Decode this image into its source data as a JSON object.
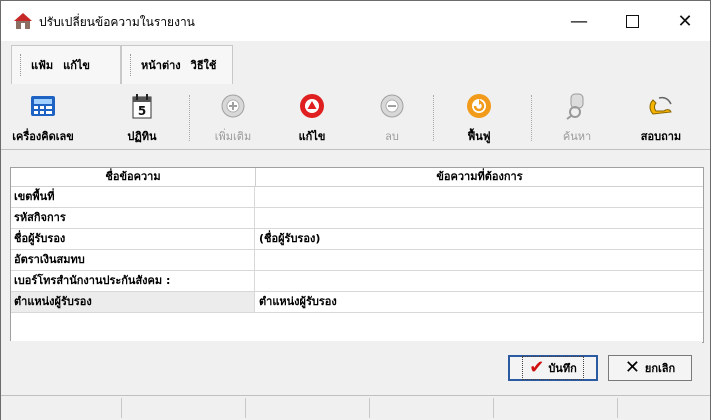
{
  "window": {
    "title": "ปรับเปลี่ยนข้อความในรายงาน",
    "min_icon": "minimize-icon",
    "max_icon": "maximize-icon",
    "close_icon": "close-icon"
  },
  "menu": {
    "file_items": [
      "แฟ้ม",
      "แก้ไข"
    ],
    "window_items": [
      "หน้าต่าง",
      "วิธีใช้"
    ]
  },
  "toolbar": {
    "calculator": "เครื่องคิดเลข",
    "calendar": "ปฏิทิน",
    "calendar_day": "5",
    "add": "เพิ่มเติม",
    "edit": "แก้ไข",
    "delete": "ลบ",
    "restore": "ฟื้นฟู",
    "search": "ค้นหา",
    "inquire": "สอบถาม"
  },
  "grid": {
    "headers": [
      "ชื่อข้อความ",
      "ข้อความที่ต้องการ"
    ],
    "rows": [
      {
        "name": "เขตพื้นที่",
        "value": ""
      },
      {
        "name": "รหัสกิจการ",
        "value": ""
      },
      {
        "name": "ชื่อผู้รับรอง",
        "value": "(ชื่อผู้รับรอง)"
      },
      {
        "name": "อัตราเงินสมทบ",
        "value": ""
      },
      {
        "name": "เบอร์โทรสำนักงานประกันสังคม :",
        "value": ""
      },
      {
        "name": "ตำแหน่งผู้รับรอง",
        "value": "ตำแหน่งผู้รับรอง"
      }
    ]
  },
  "buttons": {
    "save": "บันทึก",
    "cancel": "ยกเลิก"
  },
  "colors": {
    "edit_red": "#e02020",
    "restore_orange": "#f29a1a",
    "save_check": "#d01010"
  }
}
